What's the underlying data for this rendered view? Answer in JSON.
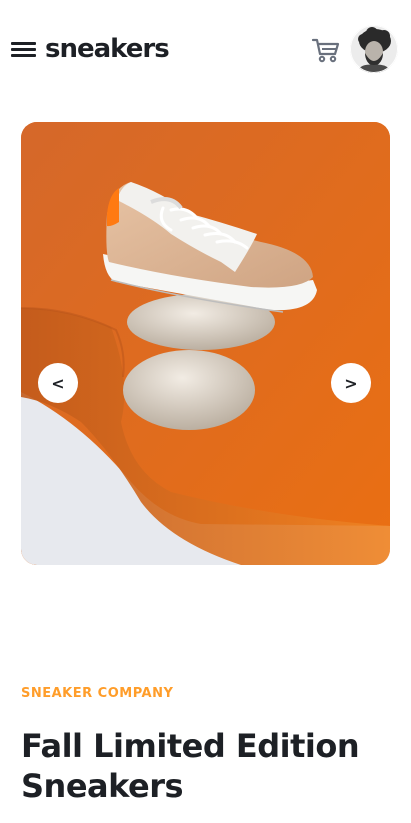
{
  "header": {
    "logo": "sneakers"
  },
  "icons": {
    "menu": "menu-icon",
    "cart": "cart-icon",
    "avatar": "avatar-icon"
  },
  "gallery": {
    "prev_label": "<",
    "next_label": ">"
  },
  "product": {
    "company": "SNEAKER COMPANY",
    "title": "Fall Limited Edition Sneakers"
  },
  "colors": {
    "accent": "#ff9d2a",
    "text": "#1d2025",
    "photo_background": "#e26b1e"
  }
}
